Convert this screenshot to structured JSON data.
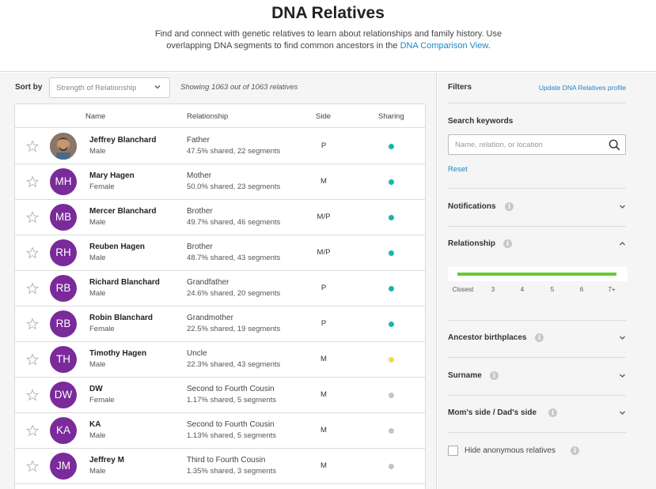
{
  "header": {
    "title": "DNA Relatives",
    "subtitle_text": "Find and connect with genetic relatives to learn about relationships and family history. Use overlapping DNA segments to find common ancestors in the ",
    "subtitle_link": "DNA Comparison View",
    "subtitle_end": "."
  },
  "sortbar": {
    "label": "Sort by",
    "selected": "Strength of Relationship",
    "showing": "Showing 1063 out of 1063 relatives"
  },
  "table": {
    "headers": {
      "name": "Name",
      "relationship": "Relationship",
      "side": "Side",
      "sharing": "Sharing"
    },
    "rows": [
      {
        "initials": "",
        "photo": true,
        "name": "Jeffrey Blanchard",
        "gender": "Male",
        "relationship": "Father",
        "shared": "47.5% shared, 22 segments",
        "side": "P",
        "sharing_color": "#1bb5a8"
      },
      {
        "initials": "MH",
        "name": "Mary Hagen",
        "gender": "Female",
        "relationship": "Mother",
        "shared": "50.0% shared, 23 segments",
        "side": "M",
        "sharing_color": "#1bb5a8"
      },
      {
        "initials": "MB",
        "name": "Mercer Blanchard",
        "gender": "Male",
        "relationship": "Brother",
        "shared": "49.7% shared, 46 segments",
        "side": "M/P",
        "sharing_color": "#1bb5a8"
      },
      {
        "initials": "RH",
        "name": "Reuben Hagen",
        "gender": "Male",
        "relationship": "Brother",
        "shared": "48.7% shared, 43 segments",
        "side": "M/P",
        "sharing_color": "#1bb5a8"
      },
      {
        "initials": "RB",
        "name": "Richard Blanchard",
        "gender": "Male",
        "relationship": "Grandfather",
        "shared": "24.6% shared, 20 segments",
        "side": "P",
        "sharing_color": "#1bb5a8"
      },
      {
        "initials": "RB",
        "name": "Robin Blanchard",
        "gender": "Female",
        "relationship": "Grandmother",
        "shared": "22.5% shared, 19 segments",
        "side": "P",
        "sharing_color": "#1bb5a8"
      },
      {
        "initials": "TH",
        "name": "Timothy Hagen",
        "gender": "Male",
        "relationship": "Uncle",
        "shared": "22.3% shared, 43 segments",
        "side": "M",
        "sharing_color": "#e8e04a"
      },
      {
        "initials": "DW",
        "name": "DW",
        "gender": "Female",
        "relationship": "Second to Fourth Cousin",
        "shared": "1.17% shared, 5 segments",
        "side": "M",
        "sharing_color": "#c4c4c4"
      },
      {
        "initials": "KA",
        "name": "KA",
        "gender": "Male",
        "relationship": "Second to Fourth Cousin",
        "shared": "1.13% shared, 5 segments",
        "side": "M",
        "sharing_color": "#c4c4c4"
      },
      {
        "initials": "JM",
        "name": "Jeffrey M",
        "gender": "Male",
        "relationship": "Third to Fourth Cousin",
        "shared": "1.35% shared, 3 segments",
        "side": "M",
        "sharing_color": "#c4c4c4"
      }
    ]
  },
  "filters": {
    "title": "Filters",
    "update_link": "Update DNA Relatives profile",
    "search_label": "Search keywords",
    "search_placeholder": "Name, relation, or location",
    "search_value": "",
    "reset": "Reset",
    "notifications": "Notifications",
    "relationship": "Relationship",
    "ticks": [
      "Closest",
      "3",
      "4",
      "5",
      "6",
      "7+"
    ],
    "ancestor_birthplaces": "Ancestor birthplaces",
    "surname": "Surname",
    "moms_dads_side": "Mom's side / Dad's side",
    "hide_anonymous": "Hide anonymous relatives",
    "hide_anonymous_checked": false
  },
  "colors": {
    "accent_link": "#1b87c9",
    "avatar": "#7a2a9a",
    "slider_green": "#6bc830"
  }
}
